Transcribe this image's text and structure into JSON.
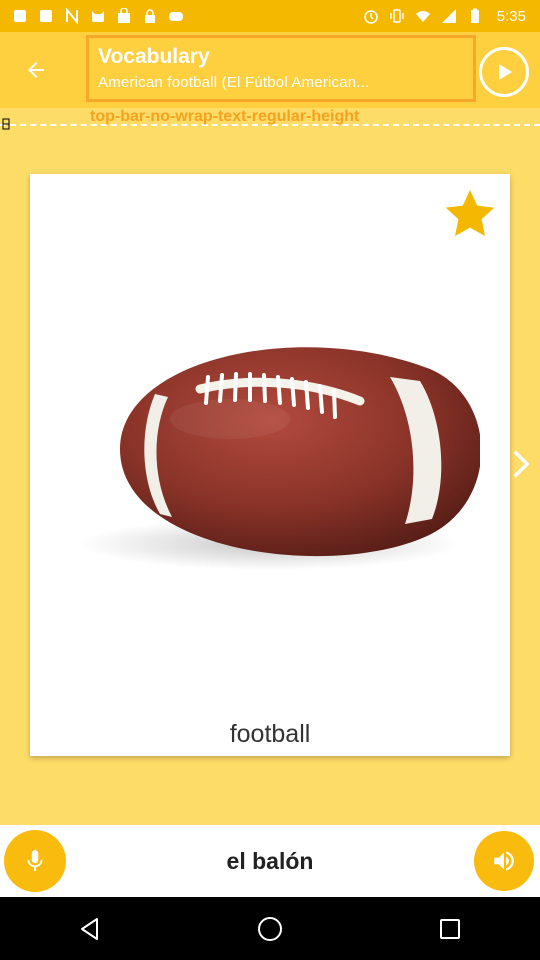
{
  "status_bar": {
    "time": "5:35",
    "left_icons": [
      "notification-icon",
      "notification-icon",
      "nfc-icon",
      "cat-icon",
      "shopping-bag-icon",
      "lock-icon",
      "game-controller-icon"
    ],
    "right_icons": [
      "alarm-icon",
      "vibrate-icon",
      "wifi-icon",
      "signal-icon",
      "battery-icon"
    ]
  },
  "app_bar": {
    "title": "Vocabulary",
    "subtitle": "American football (El Fútbol American...",
    "back_icon": "arrow-back-icon",
    "play_icon": "play-icon"
  },
  "debug": {
    "label": "top-bar-no-wrap-text-regular-height"
  },
  "card": {
    "word": "football",
    "favorite_icon": "star-icon",
    "image": "american-football-image"
  },
  "translation_bar": {
    "text": "el balón",
    "mic_icon": "microphone-icon",
    "speaker_icon": "speaker-icon"
  },
  "colors": {
    "status_bar": "#f5b800",
    "app_bar": "#fecf3e",
    "background": "#fedc68",
    "accent": "#f9bb0d",
    "title_border": "#f8a828",
    "debug_text": "#f7a21e",
    "star": "#f5b800"
  }
}
